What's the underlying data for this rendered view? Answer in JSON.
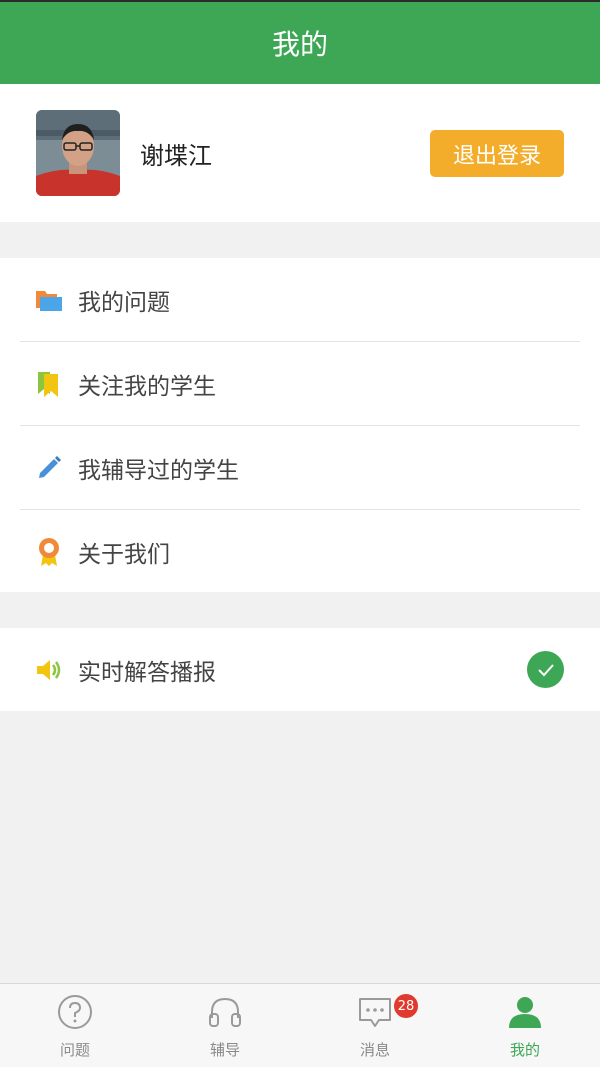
{
  "header": {
    "title": "我的"
  },
  "profile": {
    "name": "谢堞江",
    "logout_label": "退出登录"
  },
  "menu": {
    "items": [
      {
        "label": "我的问题",
        "icon": "folder-icon"
      },
      {
        "label": "关注我的学生",
        "icon": "bookmark-icon"
      },
      {
        "label": "我辅导过的学生",
        "icon": "pencil-icon"
      },
      {
        "label": "关于我们",
        "icon": "medal-icon"
      }
    ]
  },
  "broadcast": {
    "label": "实时解答播报",
    "icon": "speaker-icon",
    "enabled": true
  },
  "tabbar": {
    "tabs": [
      {
        "label": "问题",
        "icon": "question-icon"
      },
      {
        "label": "辅导",
        "icon": "headphones-icon"
      },
      {
        "label": "消息",
        "icon": "chat-icon",
        "badge": "28"
      },
      {
        "label": "我的",
        "icon": "person-icon",
        "active": true
      }
    ]
  },
  "colors": {
    "brand": "#3ea756",
    "accent": "#f3ad2b",
    "badge": "#e03a2e"
  }
}
